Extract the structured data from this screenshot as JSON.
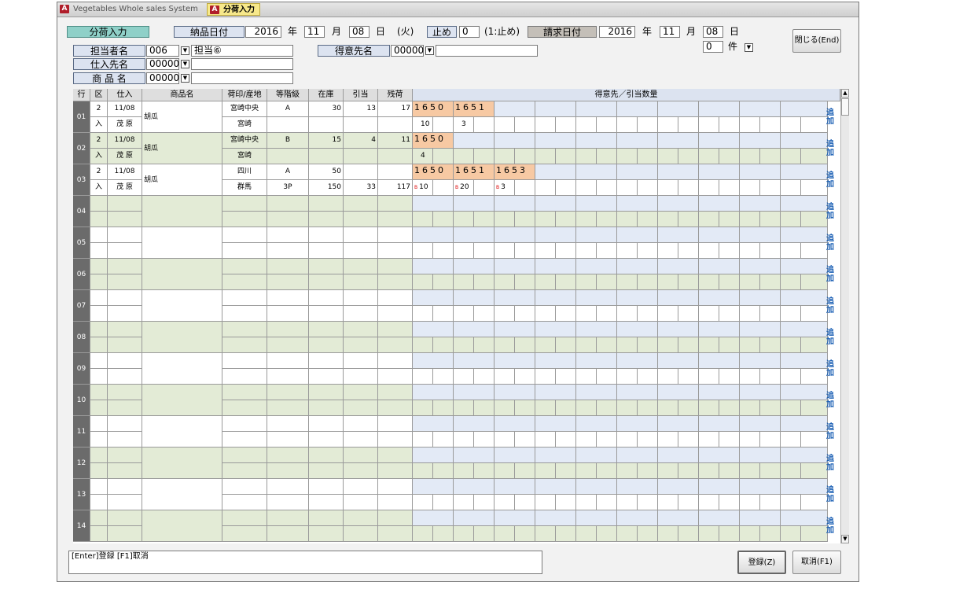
{
  "window": {
    "tab1": "Vegetables Whole sales System",
    "tab2": "分荷入力",
    "app_icon_letter": "A"
  },
  "header": {
    "title": "分荷入力",
    "delivery_date_label": "納品日付",
    "delivery_year": "2016",
    "year_unit": "年",
    "delivery_month": "11",
    "month_unit": "月",
    "delivery_day": "08",
    "day_unit": "日",
    "weekday": "(火)",
    "stop_label": "止め",
    "stop_value": "0",
    "stop_hint": "(1:止め)",
    "billing_date_label": "請求日付",
    "billing_year": "2016",
    "billing_month": "11",
    "billing_day": "08",
    "count_value": "0",
    "count_unit": "件",
    "close_button": "閉じる(End)"
  },
  "filters": {
    "staff_label": "担当者名",
    "staff_code": "006",
    "staff_name": "担当⑥",
    "supplier_label": "仕入先名",
    "supplier_code": "00000",
    "product_label": "商 品 名",
    "product_code": "00000",
    "customer_label": "得意先名",
    "customer_code": "00000"
  },
  "grid": {
    "headers": {
      "row": "行",
      "kubun": "区",
      "shiire": "仕入",
      "product": "商品名",
      "mark_origin": "荷印/産地",
      "grade": "等階級",
      "stock": "在庫",
      "allocated": "引当",
      "remaining": "残荷",
      "customers": "得意先／引当数量"
    },
    "add_label_top": "追",
    "add_label_bottom": "加",
    "rows": [
      {
        "no": "01",
        "kubun_top": "2",
        "kubun_bottom": "入",
        "date": "11/08",
        "supplier": "茂 原",
        "product": "胡瓜",
        "mark": "宮崎中央",
        "origin": "宮崎",
        "grade": "A",
        "grade2": "",
        "stock": "30",
        "stock2": "",
        "alloc": "13",
        "alloc2": "",
        "remain": "17",
        "remain2": "",
        "customers": [
          "1650",
          "1651"
        ],
        "qty": [
          "10",
          "3"
        ],
        "qty_marks": [
          "",
          ""
        ]
      },
      {
        "no": "02",
        "kubun_top": "2",
        "kubun_bottom": "入",
        "date": "11/08",
        "supplier": "茂 原",
        "product": "胡瓜",
        "mark": "宮崎中央",
        "origin": "宮崎",
        "grade": "B",
        "grade2": "",
        "stock": "15",
        "stock2": "",
        "alloc": "4",
        "alloc2": "",
        "remain": "11",
        "remain2": "",
        "customers": [
          "1650"
        ],
        "qty": [
          "4"
        ],
        "qty_marks": [
          ""
        ]
      },
      {
        "no": "03",
        "kubun_top": "2",
        "kubun_bottom": "入",
        "date": "11/08",
        "supplier": "茂 原",
        "product": "胡瓜",
        "mark": "四川",
        "origin": "群馬",
        "grade": "A",
        "grade2": "3P",
        "stock": "50",
        "stock2": "150",
        "alloc": "",
        "alloc2": "33",
        "remain": "",
        "remain2": "117",
        "customers": [
          "1650",
          "1651",
          "1653"
        ],
        "qty": [
          "10",
          "20",
          "3"
        ],
        "qty_marks": [
          "B",
          "B",
          "B"
        ]
      },
      {
        "no": "04"
      },
      {
        "no": "05"
      },
      {
        "no": "06"
      },
      {
        "no": "07"
      },
      {
        "no": "08"
      },
      {
        "no": "09"
      },
      {
        "no": "10"
      },
      {
        "no": "11"
      },
      {
        "no": "12"
      },
      {
        "no": "13"
      },
      {
        "no": "14"
      }
    ]
  },
  "footer": {
    "message": "[Enter]登録 [F1]取消",
    "register_button": "登録(Z)",
    "cancel_button": "取消(F1)"
  },
  "colors": {
    "tab_active": "#f7e88a",
    "row_green": "#e3ebd6",
    "cust_blue": "#e3eaf6",
    "cust_tag": "#f7c9a3",
    "row_number": "#6b6b6b",
    "add_link": "#1a5fb4"
  }
}
